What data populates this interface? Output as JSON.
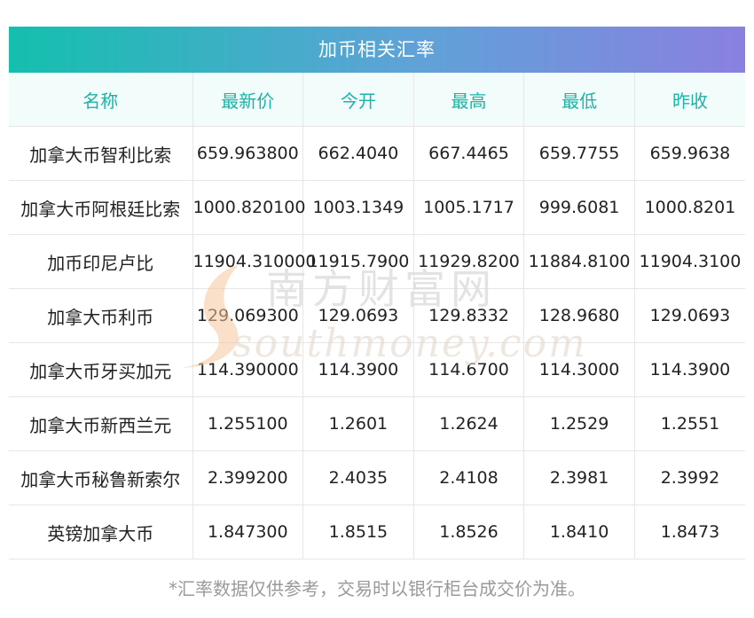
{
  "title": "加币相关汇率",
  "headers": [
    "名称",
    "最新价",
    "今开",
    "最高",
    "最低",
    "昨收"
  ],
  "rows": [
    [
      "加拿大币智利比索",
      "659.963800",
      "662.4040",
      "667.4465",
      "659.7755",
      "659.9638"
    ],
    [
      "加拿大币阿根廷比索",
      "1000.820100",
      "1003.1349",
      "1005.1717",
      "999.6081",
      "1000.8201"
    ],
    [
      "加币印尼卢比",
      "11904.310000",
      "11915.7900",
      "11929.8200",
      "11884.8100",
      "11904.3100"
    ],
    [
      "加拿大币利币",
      "129.069300",
      "129.0693",
      "129.8332",
      "128.9680",
      "129.0693"
    ],
    [
      "加拿大币牙买加元",
      "114.390000",
      "114.3900",
      "114.6700",
      "114.3000",
      "114.3900"
    ],
    [
      "加拿大币新西兰元",
      "1.255100",
      "1.2601",
      "1.2624",
      "1.2529",
      "1.2551"
    ],
    [
      "加拿大币秘鲁新索尔",
      "2.399200",
      "2.4035",
      "2.4108",
      "2.3981",
      "2.3992"
    ],
    [
      "英镑加拿大币",
      "1.847300",
      "1.8515",
      "1.8526",
      "1.8410",
      "1.8473"
    ]
  ],
  "watermark": {
    "chinese": "南方财富网",
    "english": "southmoney.com"
  },
  "footnote": "*汇率数据仅供参考，交易时以银行柜台成交价为准。"
}
